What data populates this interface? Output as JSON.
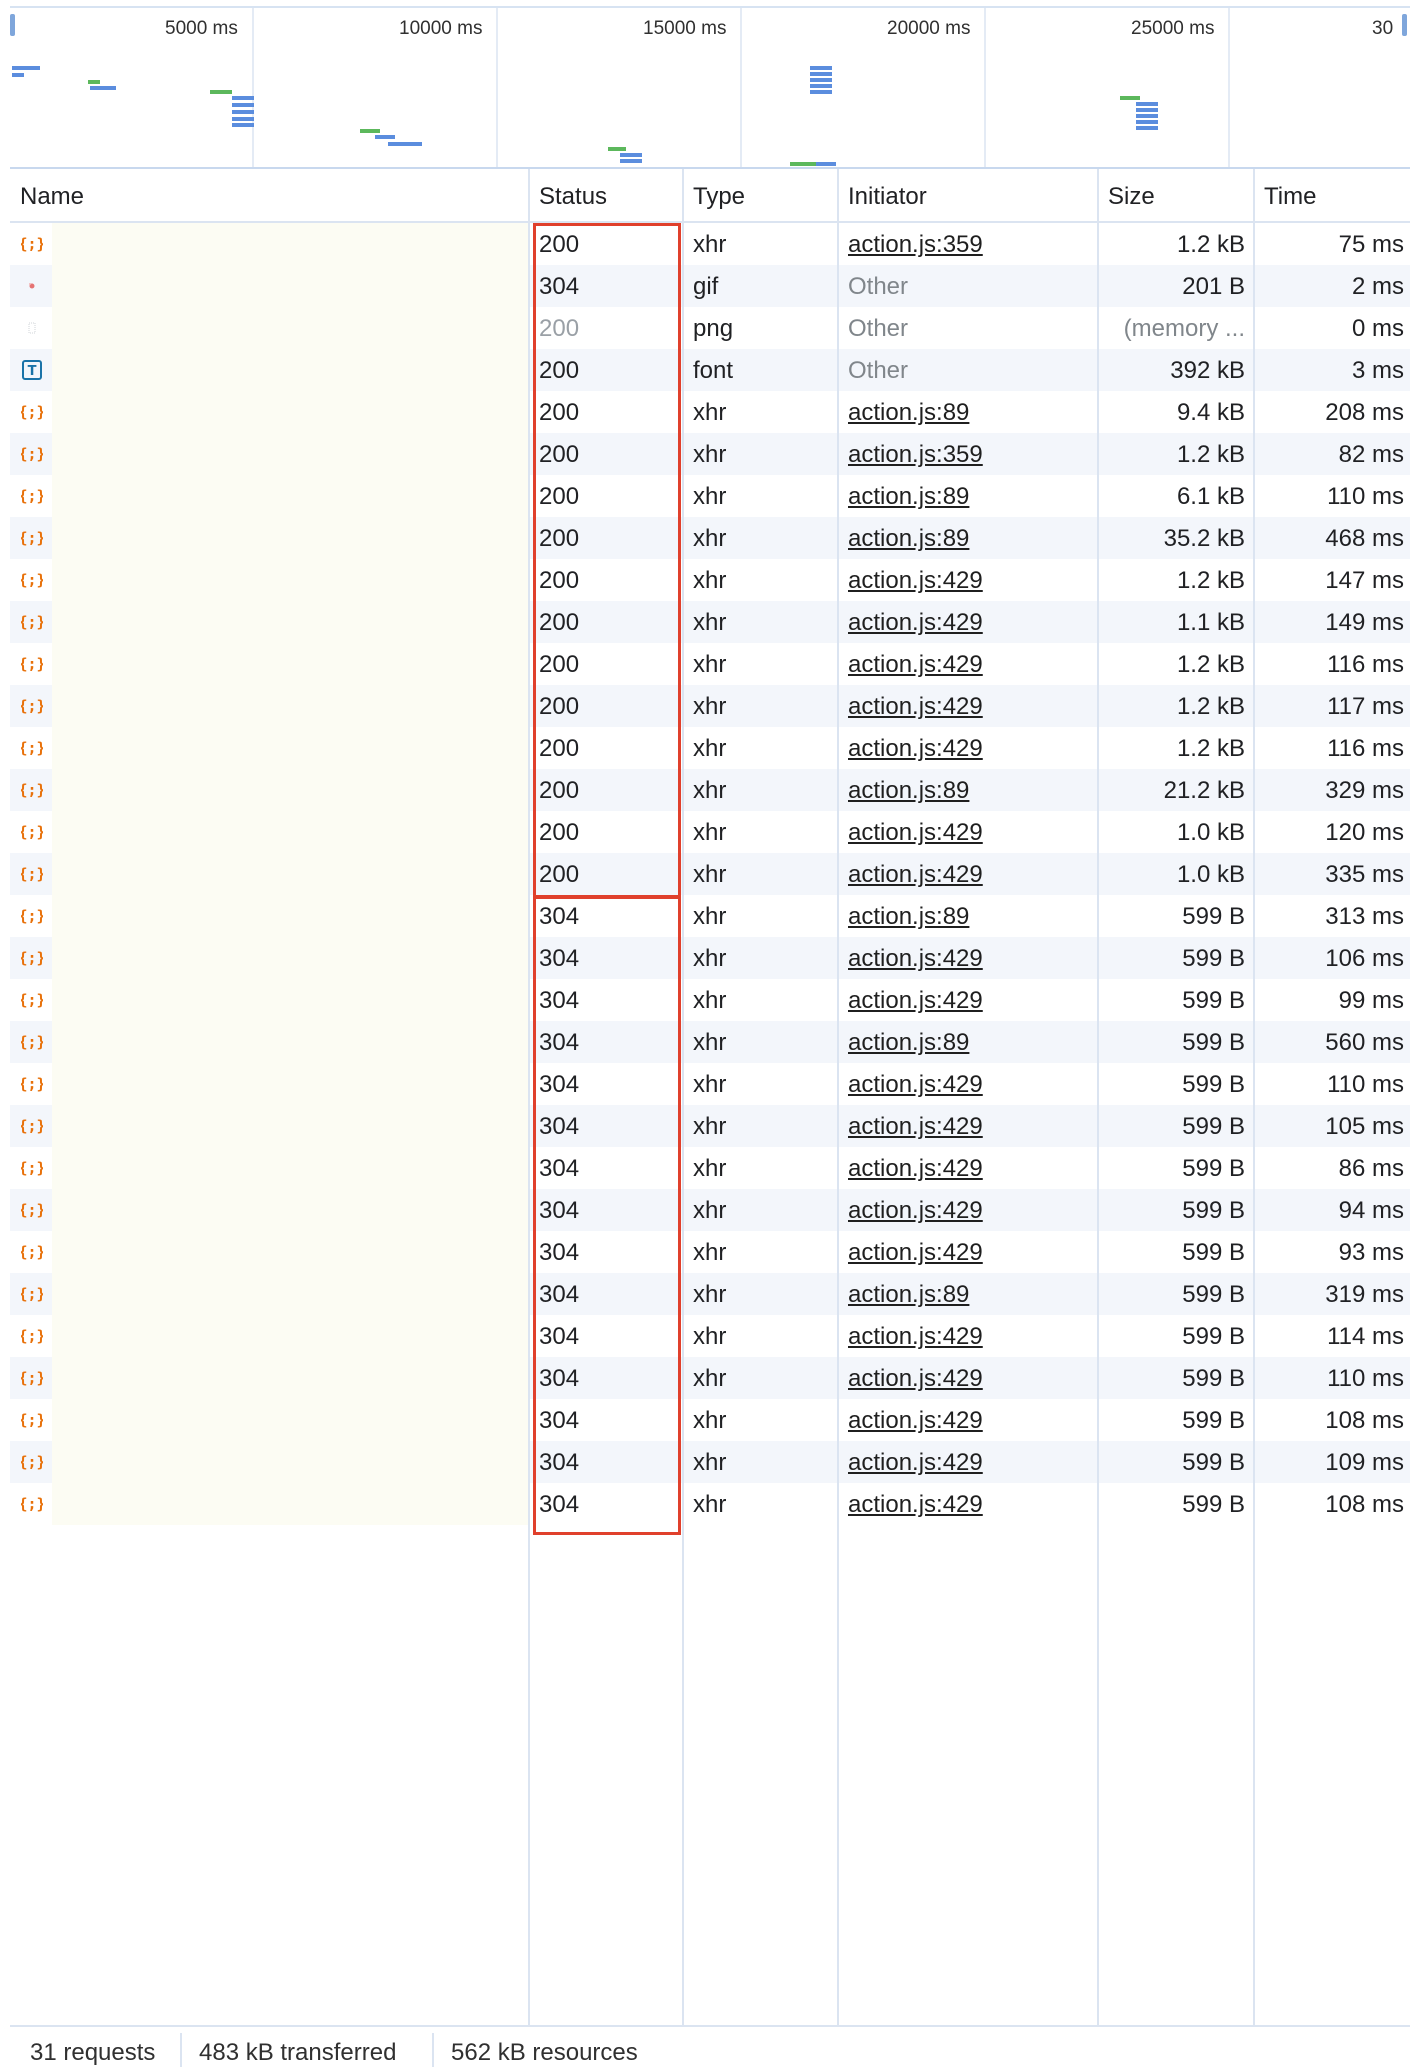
{
  "overview": {
    "ticks": [
      "5000 ms",
      "10000 ms",
      "15000 ms",
      "20000 ms",
      "25000 ms",
      "30"
    ]
  },
  "columns": {
    "name": "Name",
    "status": "Status",
    "type": "Type",
    "initiator": "Initiator",
    "size": "Size",
    "time": "Time"
  },
  "rows": [
    {
      "icon": "xhr-icon",
      "status": "200",
      "type": "xhr",
      "initiator": "action.js:359",
      "size": "1.2 kB",
      "time": "75 ms"
    },
    {
      "icon": "gif-icon",
      "status": "304",
      "type": "gif",
      "initiator": "Other",
      "size": "201 B",
      "time": "2 ms"
    },
    {
      "icon": "png-icon",
      "status": "200",
      "type": "png",
      "initiator": "Other",
      "size": "(memory ...",
      "time": "0 ms"
    },
    {
      "icon": "font-icon",
      "status": "200",
      "type": "font",
      "initiator": "Other",
      "size": "392 kB",
      "time": "3 ms"
    },
    {
      "icon": "xhr-icon",
      "status": "200",
      "type": "xhr",
      "initiator": "action.js:89",
      "size": "9.4 kB",
      "time": "208 ms"
    },
    {
      "icon": "xhr-icon",
      "status": "200",
      "type": "xhr",
      "initiator": "action.js:359",
      "size": "1.2 kB",
      "time": "82 ms"
    },
    {
      "icon": "xhr-icon",
      "status": "200",
      "type": "xhr",
      "initiator": "action.js:89",
      "size": "6.1 kB",
      "time": "110 ms"
    },
    {
      "icon": "xhr-icon",
      "status": "200",
      "type": "xhr",
      "initiator": "action.js:89",
      "size": "35.2 kB",
      "time": "468 ms"
    },
    {
      "icon": "xhr-icon",
      "status": "200",
      "type": "xhr",
      "initiator": "action.js:429",
      "size": "1.2 kB",
      "time": "147 ms"
    },
    {
      "icon": "xhr-icon",
      "status": "200",
      "type": "xhr",
      "initiator": "action.js:429",
      "size": "1.1 kB",
      "time": "149 ms"
    },
    {
      "icon": "xhr-icon",
      "status": "200",
      "type": "xhr",
      "initiator": "action.js:429",
      "size": "1.2 kB",
      "time": "116 ms"
    },
    {
      "icon": "xhr-icon",
      "status": "200",
      "type": "xhr",
      "initiator": "action.js:429",
      "size": "1.2 kB",
      "time": "117 ms"
    },
    {
      "icon": "xhr-icon",
      "status": "200",
      "type": "xhr",
      "initiator": "action.js:429",
      "size": "1.2 kB",
      "time": "116 ms"
    },
    {
      "icon": "xhr-icon",
      "status": "200",
      "type": "xhr",
      "initiator": "action.js:89",
      "size": "21.2 kB",
      "time": "329 ms"
    },
    {
      "icon": "xhr-icon",
      "status": "200",
      "type": "xhr",
      "initiator": "action.js:429",
      "size": "1.0 kB",
      "time": "120 ms"
    },
    {
      "icon": "xhr-icon",
      "status": "200",
      "type": "xhr",
      "initiator": "action.js:429",
      "size": "1.0 kB",
      "time": "335 ms"
    },
    {
      "icon": "xhr-icon",
      "status": "304",
      "type": "xhr",
      "initiator": "action.js:89",
      "size": "599 B",
      "time": "313 ms"
    },
    {
      "icon": "xhr-icon",
      "status": "304",
      "type": "xhr",
      "initiator": "action.js:429",
      "size": "599 B",
      "time": "106 ms"
    },
    {
      "icon": "xhr-icon",
      "status": "304",
      "type": "xhr",
      "initiator": "action.js:429",
      "size": "599 B",
      "time": "99 ms"
    },
    {
      "icon": "xhr-icon",
      "status": "304",
      "type": "xhr",
      "initiator": "action.js:89",
      "size": "599 B",
      "time": "560 ms"
    },
    {
      "icon": "xhr-icon",
      "status": "304",
      "type": "xhr",
      "initiator": "action.js:429",
      "size": "599 B",
      "time": "110 ms"
    },
    {
      "icon": "xhr-icon",
      "status": "304",
      "type": "xhr",
      "initiator": "action.js:429",
      "size": "599 B",
      "time": "105 ms"
    },
    {
      "icon": "xhr-icon",
      "status": "304",
      "type": "xhr",
      "initiator": "action.js:429",
      "size": "599 B",
      "time": "86 ms"
    },
    {
      "icon": "xhr-icon",
      "status": "304",
      "type": "xhr",
      "initiator": "action.js:429",
      "size": "599 B",
      "time": "94 ms"
    },
    {
      "icon": "xhr-icon",
      "status": "304",
      "type": "xhr",
      "initiator": "action.js:429",
      "size": "599 B",
      "time": "93 ms"
    },
    {
      "icon": "xhr-icon",
      "status": "304",
      "type": "xhr",
      "initiator": "action.js:89",
      "size": "599 B",
      "time": "319 ms"
    },
    {
      "icon": "xhr-icon",
      "status": "304",
      "type": "xhr",
      "initiator": "action.js:429",
      "size": "599 B",
      "time": "114 ms"
    },
    {
      "icon": "xhr-icon",
      "status": "304",
      "type": "xhr",
      "initiator": "action.js:429",
      "size": "599 B",
      "time": "110 ms"
    },
    {
      "icon": "xhr-icon",
      "status": "304",
      "type": "xhr",
      "initiator": "action.js:429",
      "size": "599 B",
      "time": "108 ms"
    },
    {
      "icon": "xhr-icon",
      "status": "304",
      "type": "xhr",
      "initiator": "action.js:429",
      "size": "599 B",
      "time": "109 ms"
    },
    {
      "icon": "xhr-icon",
      "status": "304",
      "type": "xhr",
      "initiator": "action.js:429",
      "size": "599 B",
      "time": "108 ms"
    }
  ],
  "footer": {
    "requests": "31 requests",
    "transferred": "483 kB transferred",
    "resources": "562 kB resources"
  },
  "colors": {
    "highlight": "#e0402c",
    "xhr_icon": "#e8710a",
    "font_icon": "#1a73a8",
    "bar_green": "#5cb85c",
    "bar_blue": "#5b8dde"
  }
}
